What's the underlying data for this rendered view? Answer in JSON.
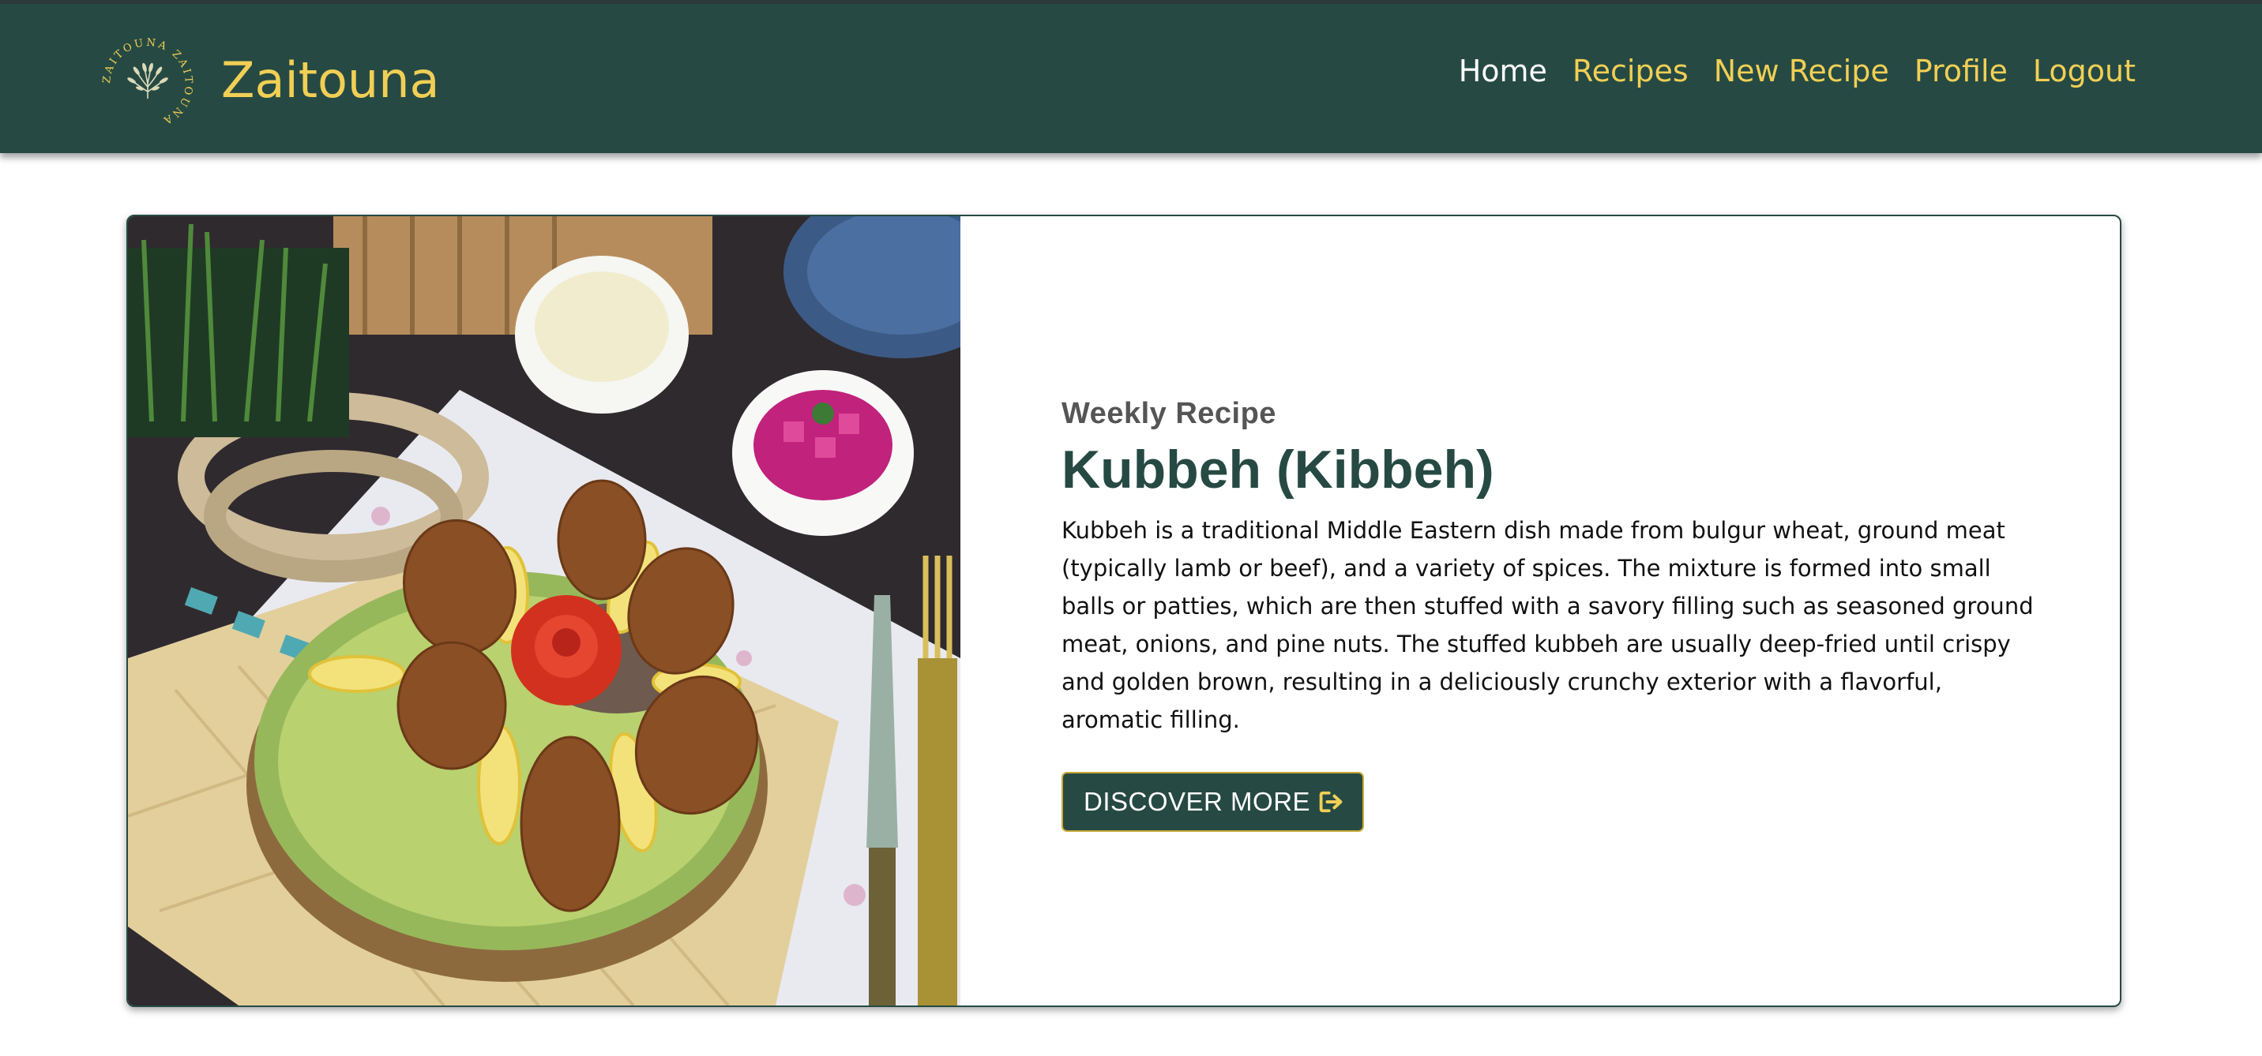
{
  "brand": {
    "name": "Zaitouna",
    "logo_icon": "olive-wreath-logo-icon",
    "logo_text": "ZAITOUNA ZAITOUNA"
  },
  "nav": {
    "items": [
      {
        "label": "Home",
        "active": true
      },
      {
        "label": "Recipes",
        "active": false
      },
      {
        "label": "New Recipe",
        "active": false
      },
      {
        "label": "Profile",
        "active": false
      },
      {
        "label": "Logout",
        "active": false
      }
    ]
  },
  "feature": {
    "eyebrow": "Weekly Recipe",
    "title": "Kubbeh (Kibbeh)",
    "description": "Kubbeh is a traditional Middle Eastern dish made from bulgur wheat, ground meat (typically lamb or beef), and a variety of spices. The mixture is formed into small balls or patties, which are then stuffed with a savory filling such as seasoned ground meat, onions, and pine nuts. The stuffed kubbeh are usually deep-fried until crispy and golden brown, resulting in a deliciously crunchy exterior with a flavorful, aromatic filling.",
    "button_label": "DISCOVER MORE",
    "button_icon": "sign-out-arrow-icon"
  },
  "colors": {
    "primary": "#264a43",
    "accent": "#f1cf55",
    "text": "#111111",
    "muted": "#555555"
  }
}
